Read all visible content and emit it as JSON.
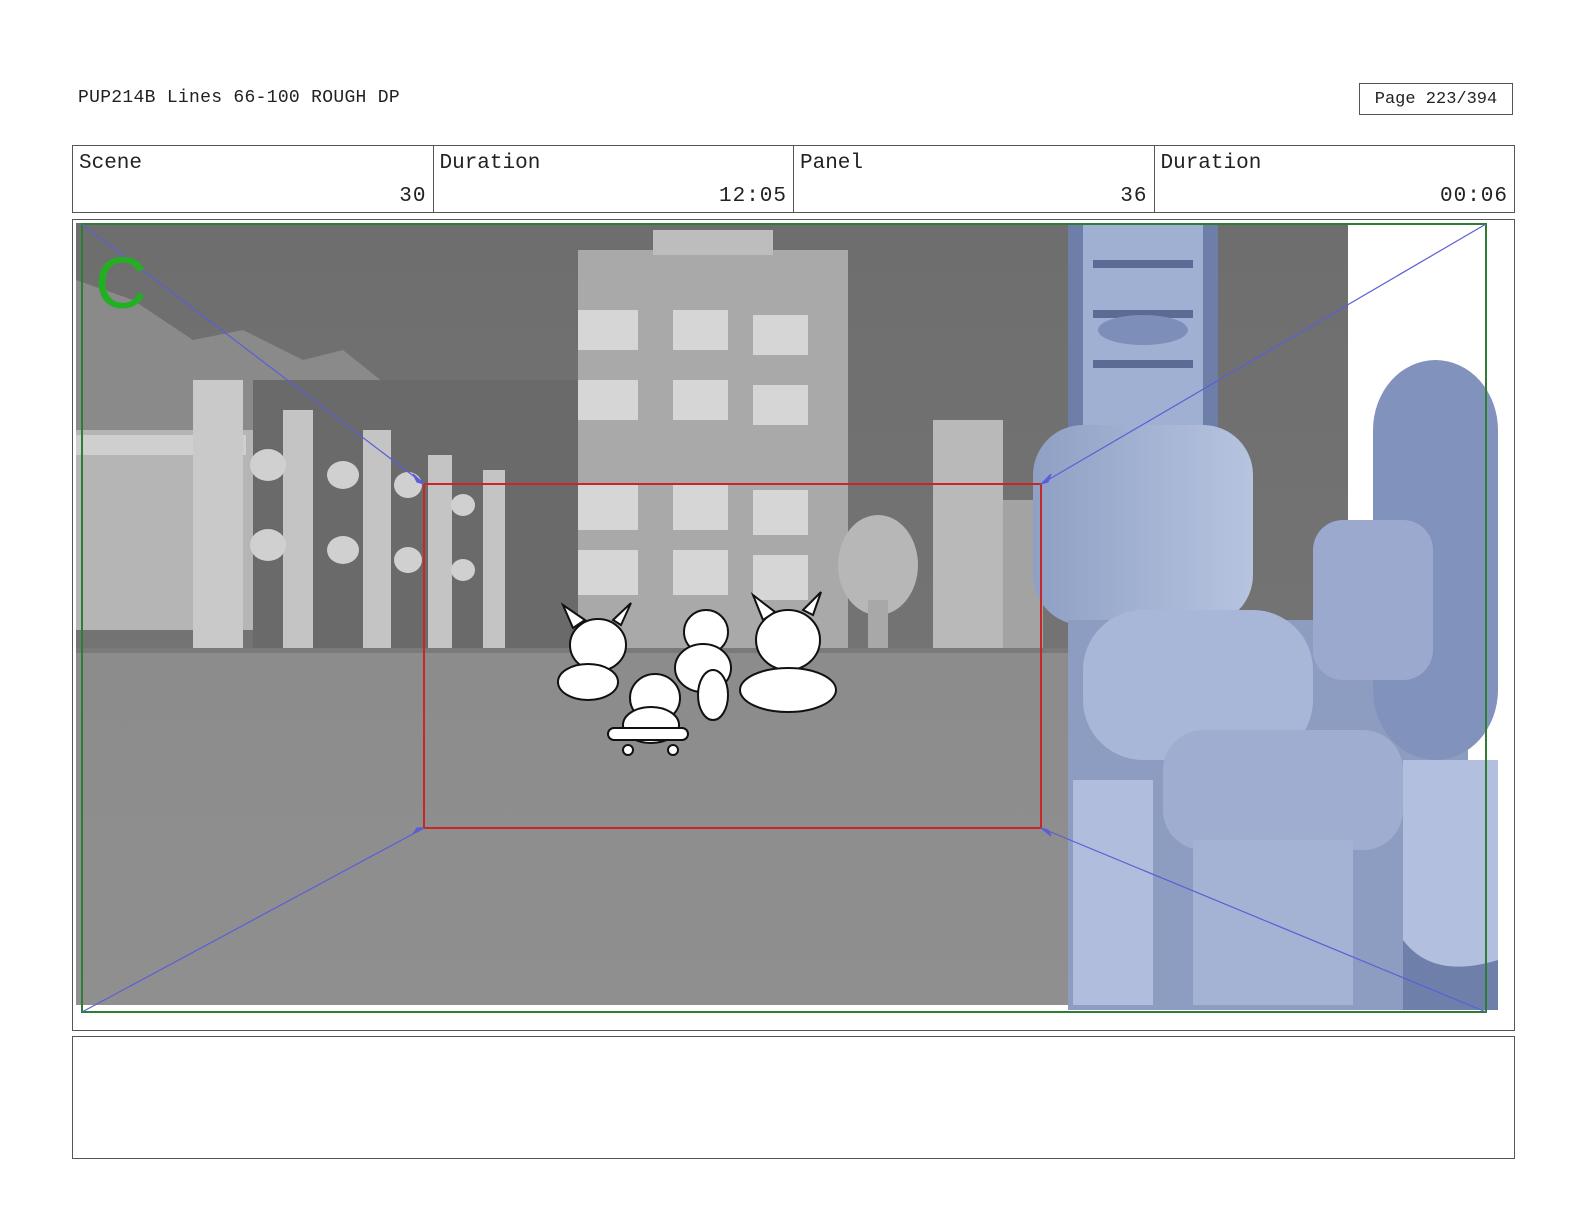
{
  "header": {
    "title": "PUP214B Lines 66-100 ROUGH DP",
    "page": "Page 223/394"
  },
  "info": [
    {
      "label": "Scene",
      "value": "30"
    },
    {
      "label": "Duration",
      "value": "12:05"
    },
    {
      "label": "Panel",
      "value": "36"
    },
    {
      "label": "Duration",
      "value": "00:06"
    }
  ],
  "panel": {
    "camera_marker": "C",
    "colors": {
      "safe_frame": "#2e7d32",
      "camera_frame": "#c62828",
      "move_arrows": "#5a5fd6",
      "marker": "#22b022"
    }
  },
  "notes": {
    "text": ""
  }
}
